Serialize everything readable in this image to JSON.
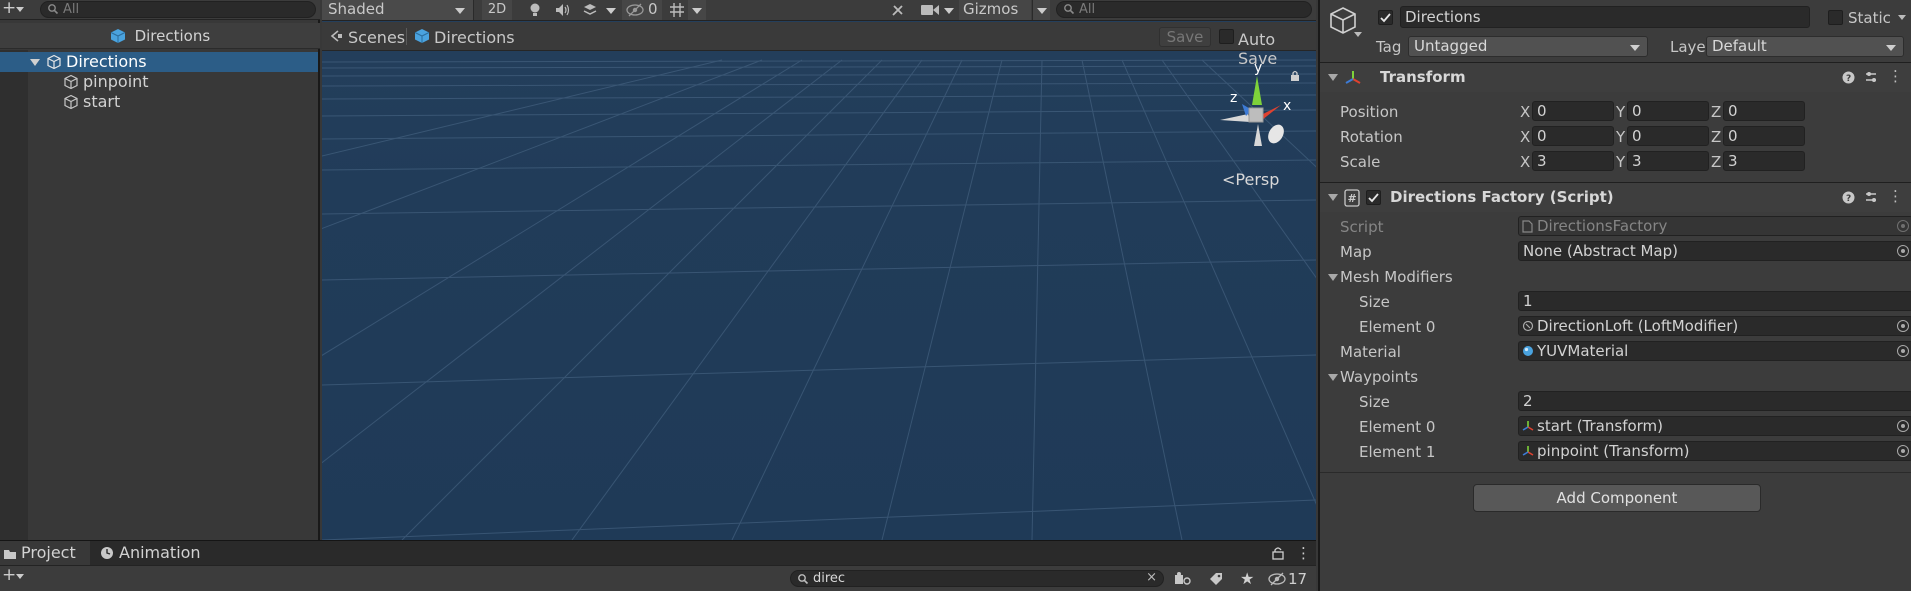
{
  "hierarchy": {
    "search_placeholder": "All",
    "scene_title": "Directions",
    "items": [
      {
        "label": "Directions"
      },
      {
        "label": "pinpoint"
      },
      {
        "label": "start"
      }
    ]
  },
  "scene_view": {
    "shading_mode": "Shaded",
    "btn_2d": "2D",
    "hidden_count": "0",
    "gizmos_label": "Gizmos",
    "search_placeholder": "All",
    "breadcrumb_root": "Scenes",
    "breadcrumb_current": "Directions",
    "save_label": "Save",
    "autosave_label": "Auto Save",
    "projection_label": "Persp",
    "axis_x": "x",
    "axis_y": "y",
    "axis_z": "z"
  },
  "bottom": {
    "tabs": [
      {
        "label": "Project"
      },
      {
        "label": "Animation"
      }
    ],
    "search_value": "direc",
    "hidden_count": "17"
  },
  "inspector": {
    "object_name": "Directions",
    "static_label": "Static",
    "tag_label": "Tag",
    "tag_value": "Untagged",
    "layer_label": "Layer",
    "layer_value": "Default",
    "transform": {
      "title": "Transform",
      "rows": [
        {
          "label": "Position",
          "x": "0",
          "y": "0",
          "z": "0"
        },
        {
          "label": "Rotation",
          "x": "0",
          "y": "0",
          "z": "0"
        },
        {
          "label": "Scale",
          "x": "3",
          "y": "3",
          "z": "3"
        }
      ],
      "axis_x": "X",
      "axis_y": "Y",
      "axis_z": "Z"
    },
    "script_component": {
      "title": "Directions Factory (Script)",
      "script_label": "Script",
      "script_value": "DirectionsFactory",
      "map_label": "Map",
      "map_value": "None (Abstract Map)",
      "mesh_modifiers_label": "Mesh Modifiers",
      "mesh_size_label": "Size",
      "mesh_size_value": "1",
      "mesh_el0_label": "Element 0",
      "mesh_el0_value": "DirectionLoft (LoftModifier)",
      "material_label": "Material",
      "material_value": "YUVMaterial",
      "waypoints_label": "Waypoints",
      "wp_size_label": "Size",
      "wp_size_value": "2",
      "wp_el0_label": "Element 0",
      "wp_el0_value": "start (Transform)",
      "wp_el1_label": "Element 1",
      "wp_el1_value": "pinpoint (Transform)"
    },
    "add_component_label": "Add Component"
  },
  "colors": {
    "selection": "#2c5d87",
    "scene_background": "#203a56",
    "panel": "#383838",
    "axis_x": "#e0412f",
    "axis_y": "#7ed23a",
    "axis_z": "#3d7bd6"
  }
}
